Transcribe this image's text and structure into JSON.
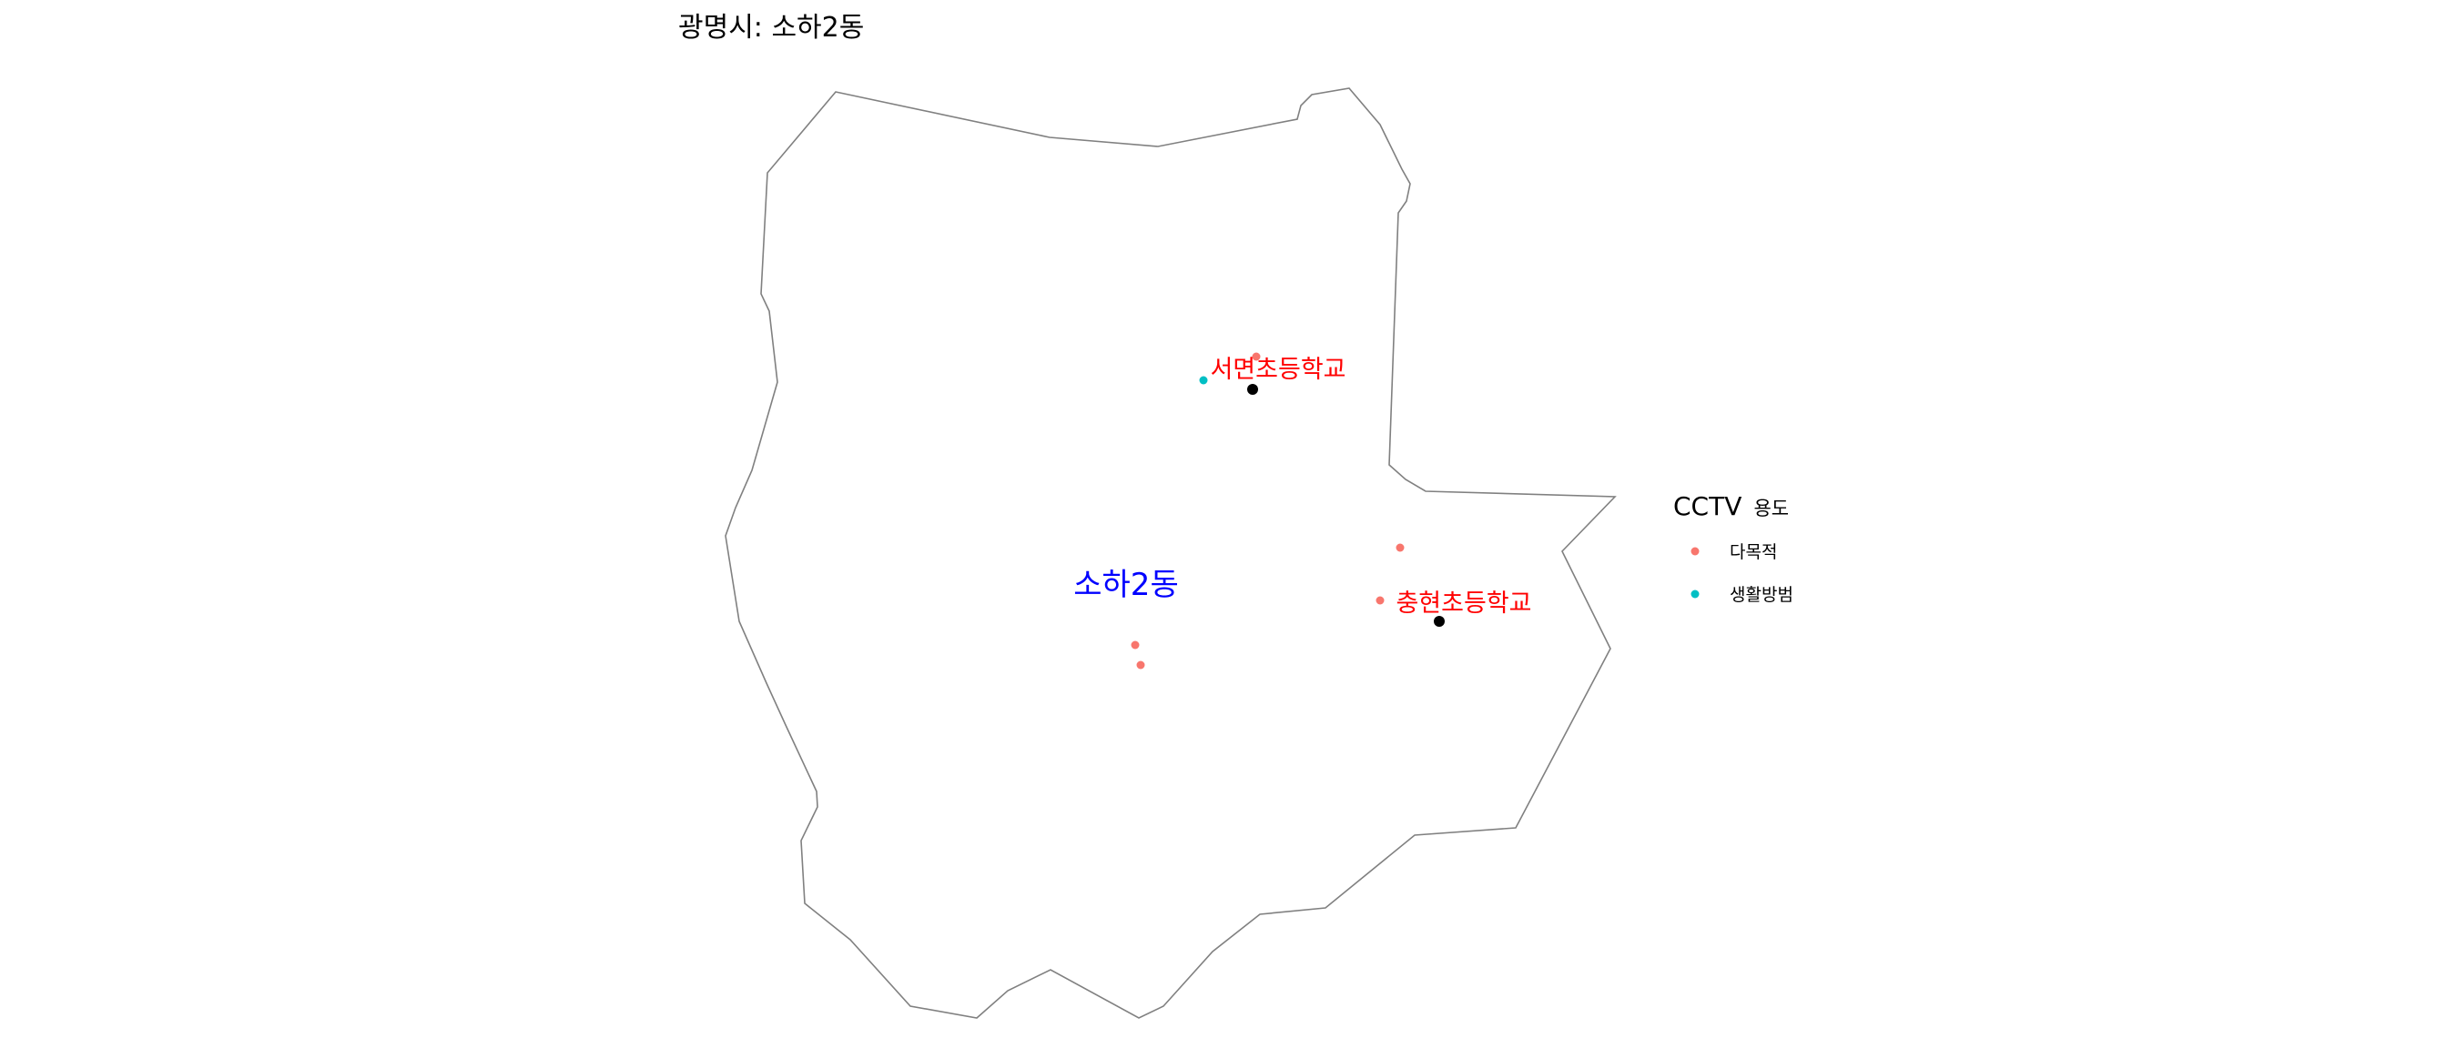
{
  "map": {
    "title": "광명시: 소하2동",
    "district_label": "소하2동",
    "district_label_color": "#0000ff",
    "boundary_color": "#808080",
    "school_label_color": "#ff0000",
    "school_marker_color": "#000000",
    "schools": [
      {
        "name": "서면초등학교"
      },
      {
        "name": "충현초등학교"
      }
    ],
    "cctv_points": [
      {
        "type": "생활방범"
      },
      {
        "type": "다목적"
      },
      {
        "type": "다목적"
      },
      {
        "type": "다목적"
      },
      {
        "type": "다목적"
      },
      {
        "type": "다목적"
      }
    ]
  },
  "legend": {
    "title_main": "CCTV",
    "title_sub": "용도",
    "items": [
      {
        "label": "다목적",
        "color": "#f8766d"
      },
      {
        "label": "생활방범",
        "color": "#00bfc4"
      }
    ]
  }
}
